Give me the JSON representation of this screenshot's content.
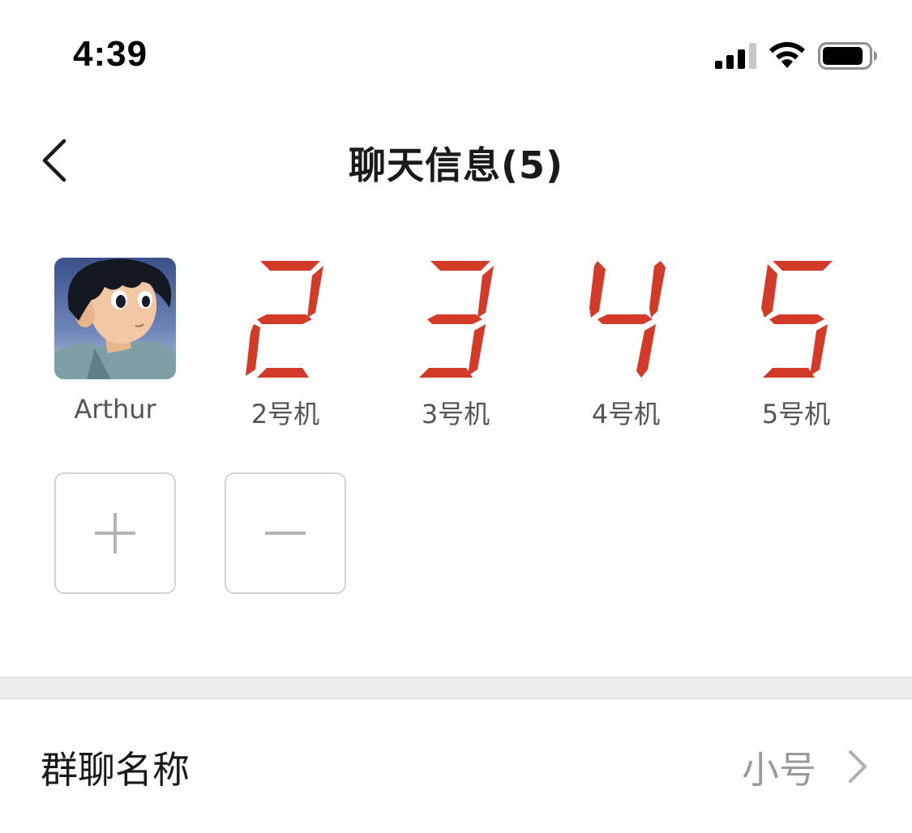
{
  "status_bar": {
    "time": "4:39"
  },
  "nav": {
    "title": "聊天信息(5)"
  },
  "members": [
    {
      "name": "Arthur",
      "avatar": "anime-boy-avatar"
    },
    {
      "name": "2号机",
      "avatar": "red-seven-segment-digit",
      "digit": 2
    },
    {
      "name": "3号机",
      "avatar": "red-seven-segment-digit",
      "digit": 3
    },
    {
      "name": "4号机",
      "avatar": "red-seven-segment-digit",
      "digit": 4
    },
    {
      "name": "5号机",
      "avatar": "red-seven-segment-digit",
      "digit": 5
    }
  ],
  "actions": {
    "add_icon": "plus-icon",
    "remove_icon": "minus-icon"
  },
  "group_settings": {
    "name_label": "群聊名称",
    "name_value": "小号"
  },
  "colors": {
    "digit_red": "#d33a27",
    "border": "#d2d2d2",
    "muted_text": "#9a9a9a"
  }
}
